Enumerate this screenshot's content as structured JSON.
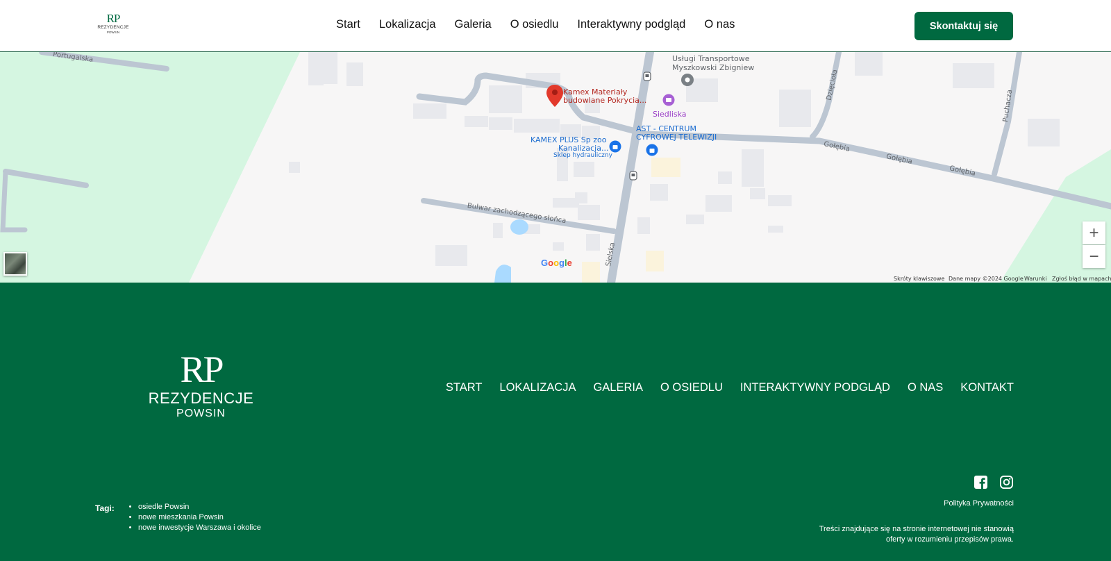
{
  "header": {
    "logo": {
      "monogram": "RP",
      "brand": "REZYDENCJE",
      "sub": "POWSIN"
    },
    "nav": [
      "Start",
      "Lokalizacja",
      "Galeria",
      "O osiedlu",
      "Interaktywny podgląd",
      "O nas"
    ],
    "cta_label": "Skontaktuj się"
  },
  "map": {
    "labels": {
      "portugalska": "Portugalska",
      "uslugi_1": "Usługi Transportowe",
      "uslugi_2": "Myszkowski Zbigniew",
      "kamex_1": "Kamex Materiały",
      "kamex_2": "budowlane Pokrycia...",
      "siedliska": "Siedliska",
      "ast_1": "AST - CENTRUM",
      "ast_2": "CYFROWEJ TELEWIZJI",
      "kamex_plus_1": "KAMEX PLUS Sp zoo",
      "kamex_plus_2": "Kanalizacja...",
      "kamex_plus_3": "Sklep hydrauliczny",
      "dzieciola": "Dzięcioła",
      "puchacza": "Puchacza",
      "golebia": "Gołębia",
      "bulwar": "Bulwar zachodzącego słońca",
      "sielska": "Sielska"
    },
    "google": "Google",
    "zoom_in": "+",
    "zoom_out": "−",
    "attrib": {
      "shortcuts": "Skróty klawiszowe",
      "data": "Dane mapy ©2024 Google",
      "terms": "Warunki",
      "report": "Zgłoś błąd w mapach"
    },
    "colors": {
      "park": "#d5f6e1",
      "road": "#b9c3cf",
      "building": "#e8e9ed",
      "pin": "#e2392b",
      "poi_blue": "#1a73e8",
      "poi_purple": "#a760d4"
    }
  },
  "footer": {
    "logo": {
      "monogram": "RP",
      "brand": "REZYDENCJE",
      "sub": "POWSIN"
    },
    "nav": [
      "START",
      "LOKALIZACJA",
      "GALERIA",
      "O OSIEDLU",
      "INTERAKTYWNY PODGLĄD",
      "O NAS",
      "KONTAKT"
    ],
    "privacy": "Polityka Prywatności",
    "disclaimer": "Treści znajdujące się na stronie internetowej nie stanowią oferty w rozumieniu przepisów prawa.",
    "tags_label": "Tagi:",
    "tags": [
      "osiedle Powsin",
      "nowe mieszkania Powsin",
      "nowe inwestycje Warszawa i okolice"
    ],
    "social_icons": [
      "facebook-icon",
      "instagram-icon"
    ]
  },
  "brand_color": "#006940"
}
